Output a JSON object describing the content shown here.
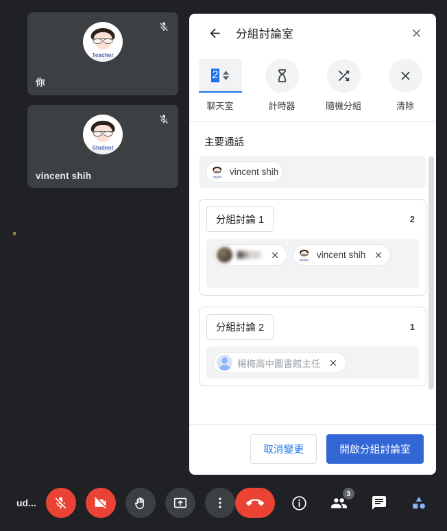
{
  "stage": {
    "tiles": [
      {
        "name": "你",
        "avatar_label": "Teacher",
        "mic_state_icon": "mic-off-icon"
      },
      {
        "name": "vincent shih",
        "avatar_label": "Student",
        "mic_state_icon": "mic-off-icon"
      }
    ]
  },
  "panel": {
    "title": "分組討論室",
    "back_icon": "arrow-back-icon",
    "close_icon": "close-icon",
    "toolbar": {
      "rooms_count": "2",
      "rooms_label": "聊天室",
      "timer_label": "計時器",
      "timer_icon": "hourglass-icon",
      "shuffle_label": "隨機分組",
      "shuffle_icon": "shuffle-icon",
      "clear_label": "清除",
      "clear_icon": "close-icon"
    },
    "main_call": {
      "title": "主要通話",
      "participants": [
        {
          "name": "vincent shih",
          "avatar_label": "Teacher",
          "removable": false,
          "blurred": false,
          "muted": false
        }
      ]
    },
    "rooms": [
      {
        "name": "分組討論 1",
        "count": "2",
        "participants": [
          {
            "name": "",
            "avatar_label": "",
            "removable": true,
            "blurred": true,
            "muted": false
          },
          {
            "name": "vincent shih",
            "avatar_label": "Student",
            "removable": true,
            "blurred": false,
            "muted": false
          }
        ]
      },
      {
        "name": "分組討論 2",
        "count": "1",
        "participants": [
          {
            "name": "楊梅高中圖書館主任",
            "avatar_label": "",
            "removable": true,
            "blurred": false,
            "muted": true
          }
        ]
      }
    ],
    "footer": {
      "cancel_label": "取消變更",
      "confirm_label": "開啟分組討論室"
    }
  },
  "controls": {
    "meeting_label": "ud...",
    "left": [
      {
        "icon": "mic-off-icon",
        "style": "red"
      },
      {
        "icon": "camera-off-icon",
        "style": "red"
      },
      {
        "icon": "raise-hand-icon",
        "style": "grey"
      },
      {
        "icon": "present-screen-icon",
        "style": "grey"
      },
      {
        "icon": "more-options-icon",
        "style": "grey"
      }
    ],
    "right": [
      {
        "icon": "hangup-icon",
        "style": "hangup",
        "badge": ""
      },
      {
        "icon": "info-icon",
        "style": "plain",
        "badge": ""
      },
      {
        "icon": "people-icon",
        "style": "plain",
        "badge": "3"
      },
      {
        "icon": "chat-icon",
        "style": "plain",
        "badge": ""
      },
      {
        "icon": "activities-icon",
        "style": "plain",
        "badge": ""
      },
      {
        "icon": "host-controls-icon",
        "style": "plain",
        "badge": ""
      }
    ]
  },
  "colors": {
    "background": "#202124",
    "tile": "#3c4043",
    "accent_blue": "#1a73e8",
    "primary_button": "#3367d6",
    "danger_red": "#ea4335",
    "panel_white": "#ffffff"
  }
}
